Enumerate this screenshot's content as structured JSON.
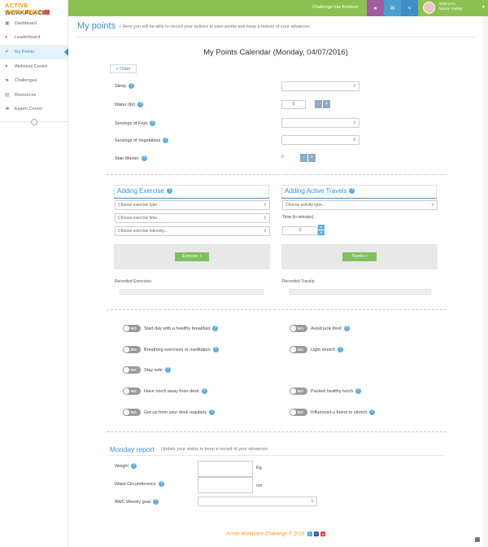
{
  "header": {
    "logo_line1": "ACTIVE",
    "logo_line1b": "WORKPLACE",
    "logo_line2": "CHALLENGE",
    "challenge_status": "Challenge has finished.",
    "user_welcome": "Welcome,",
    "user_name": "Martin Parker",
    "brand_color": "#8cc152"
  },
  "sidebar": {
    "items": [
      {
        "label": "Dashboard",
        "icon": "dashboard-icon"
      },
      {
        "label": "Leaderboard",
        "icon": "trophy-icon"
      },
      {
        "label": "My Points",
        "icon": "check-circle-icon"
      },
      {
        "label": "Wellness Centre",
        "icon": "heart-icon"
      },
      {
        "label": "Challenges",
        "icon": "flag-icon"
      },
      {
        "label": "Resources",
        "icon": "book-icon"
      },
      {
        "label": "Expert Corner",
        "icon": "user-icon"
      }
    ],
    "active_index": 2
  },
  "page": {
    "title": "My points",
    "subtitle": "» Here you will be able to record your actions to earn points and keep a history of your advances",
    "calendar_title": "My Points Calendar (Monday, 04/07/2016)",
    "older_label": "« Older"
  },
  "fields": {
    "sleep": "Sleep",
    "water": "Water (litr)",
    "water_value": "0",
    "fruit": "Servings of Fruit",
    "vegetables": "Servings of Vegetables",
    "stairs": "Stair Master",
    "stairs_value": "0"
  },
  "exercise": {
    "title": "Adding Exercise",
    "type_placeholder": "Choose exercise type...",
    "time_placeholder": "Choose exercise time...",
    "intensity_placeholder": "Choose exercise intensity...",
    "add_label": "Exercise +",
    "recorded_label": "Recorded Exercises:"
  },
  "travel": {
    "title": "Adding Active Travels",
    "type_placeholder": "Choose activity type...",
    "time_label": "Time (in minutes):",
    "time_value": "0",
    "add_label": "Travels +",
    "recorded_label": "Recorded Travels:"
  },
  "habits": {
    "toggle_text": "NO",
    "left": [
      "Start day with a healthy breakfast",
      "Breathing exercises or meditation",
      "Stay safe",
      "Have lunch away from desk",
      "Get up from your desk regularly"
    ],
    "right": [
      "Avoid junk food",
      "Light stretch",
      "Packed healthy lunch",
      "Influenced a friend to stretch"
    ]
  },
  "report": {
    "title": "Monday report",
    "subtitle": "Update your status to keep a record of your advances",
    "weight_label": "Weight",
    "weight_unit": "Kg",
    "waist_label": "Waist Circumference",
    "waist_unit": "cm",
    "goal_label": "AWC Weekly goal"
  },
  "footer": {
    "text": "Active Workplace Challenge © 2016"
  }
}
